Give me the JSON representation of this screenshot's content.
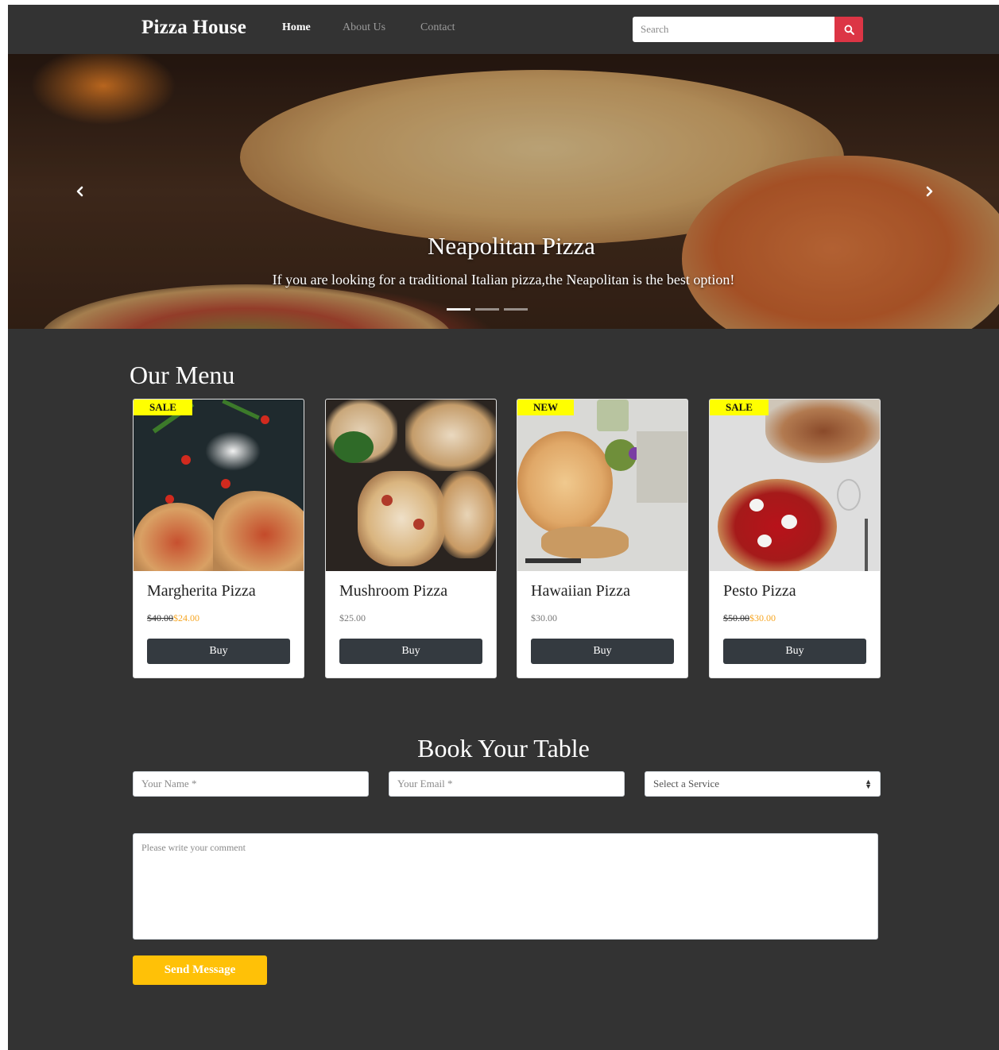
{
  "navbar": {
    "brand": "Pizza House",
    "links": [
      {
        "label": "Home",
        "active": true
      },
      {
        "label": "About Us",
        "active": false
      },
      {
        "label": "Contact",
        "active": false
      }
    ],
    "search": {
      "placeholder": "Search",
      "button_icon": "search-icon",
      "button_color": "#dc3545"
    }
  },
  "hero": {
    "slide_title": "Neapolitan Pizza",
    "slide_text": "If you are looking for a traditional Italian pizza,the Neapolitan is the best option!",
    "prev_icon": "chevron-left-icon",
    "next_icon": "chevron-right-icon",
    "indicator_count": 3,
    "active_indicator": 0
  },
  "menu": {
    "title": "Our Menu",
    "items": [
      {
        "name": "Margherita Pizza",
        "badge": "SALE",
        "old_price": "$40.00",
        "price": "$24.00",
        "button": "Buy"
      },
      {
        "name": "Mushroom Pizza",
        "badge": "",
        "old_price": "",
        "price": "$25.00",
        "button": "Buy"
      },
      {
        "name": "Hawaiian Pizza",
        "badge": "NEW",
        "old_price": "",
        "price": "$30.00",
        "button": "Buy"
      },
      {
        "name": "Pesto Pizza",
        "badge": "SALE",
        "old_price": "$50.00",
        "price": "$30.00",
        "button": "Buy"
      }
    ]
  },
  "booking": {
    "title": "Book Your Table",
    "name_placeholder": "Your Name *",
    "email_placeholder": "Your Email *",
    "service_selected": "Select a Service",
    "comment_placeholder": "Please write your comment",
    "submit_label": "Send Message"
  },
  "colors": {
    "background": "#333333",
    "badge": "#ffff00",
    "sale_price": "#f6a623",
    "buy_button": "#343a40",
    "send_button": "#ffc107"
  }
}
